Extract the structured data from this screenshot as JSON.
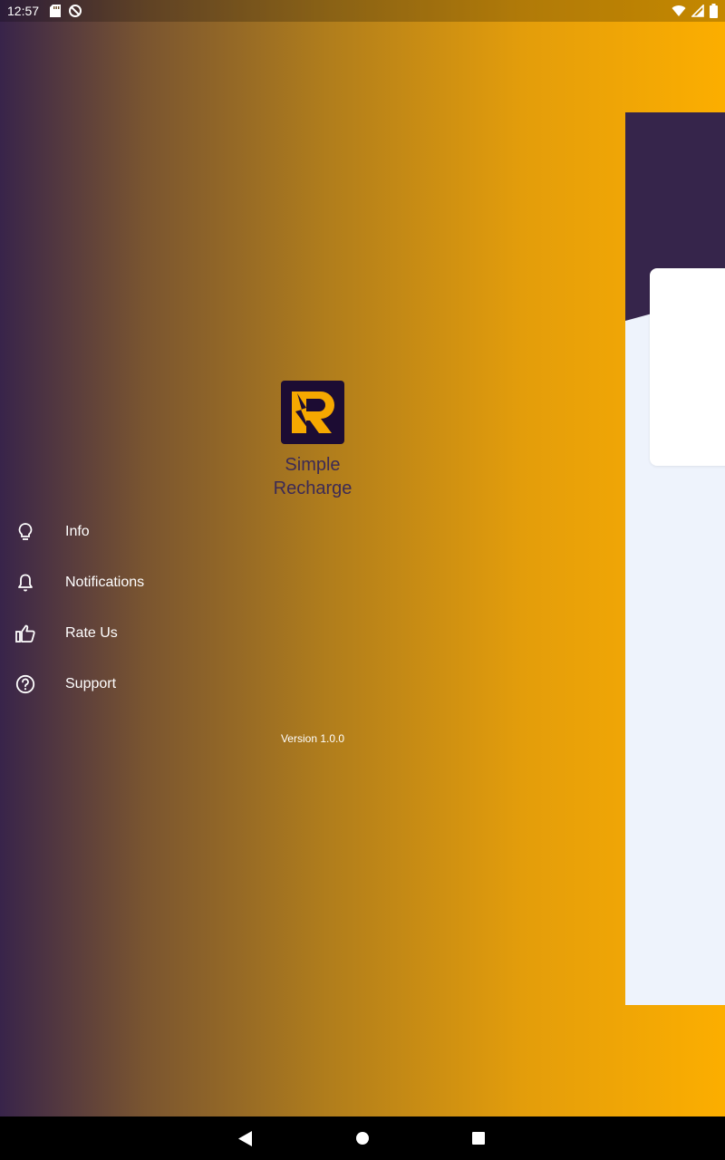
{
  "status_bar": {
    "time": "12:57",
    "left_icons": [
      "sd-card-icon",
      "sync-disabled-icon"
    ],
    "right_icons": [
      "wifi-icon",
      "signal-icon",
      "battery-icon"
    ]
  },
  "app": {
    "name_line1": "Simple",
    "name_line2": "Recharge",
    "logo": "app-logo-icon"
  },
  "menu": {
    "items": [
      {
        "label": "Info",
        "icon": "lightbulb-icon"
      },
      {
        "label": "Notifications",
        "icon": "bell-icon"
      },
      {
        "label": "Rate Us",
        "icon": "thumbs-up-icon"
      },
      {
        "label": "Support",
        "icon": "help-circle-icon"
      }
    ]
  },
  "version_label": "Version 1.0.0",
  "nav_bar": {
    "buttons": [
      "back-icon",
      "home-icon",
      "recents-icon"
    ]
  },
  "colors": {
    "gradient_start": "#38244a",
    "gradient_end": "#fcae00",
    "panel_header": "#36254b",
    "panel_body": "#eef3fc",
    "logo_bg": "#1c0c33",
    "logo_accent": "#f6a800",
    "app_name": "#3c2a55"
  }
}
